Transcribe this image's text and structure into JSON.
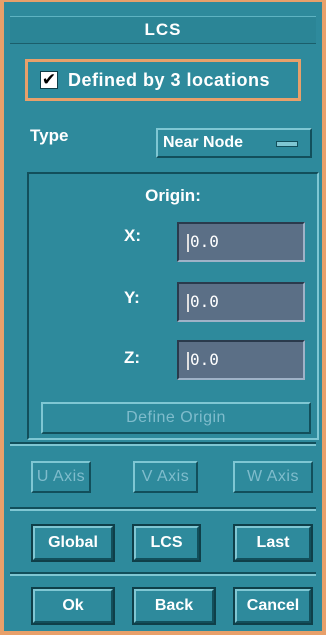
{
  "window": {
    "title": "LCS"
  },
  "checkbox": {
    "label": "Defined by 3 locations",
    "checked": true
  },
  "type": {
    "label": "Type",
    "selected": "Near Node"
  },
  "origin": {
    "title": "Origin:",
    "x_label": "X:",
    "x_value": "0.0",
    "y_label": "Y:",
    "y_value": "0.0",
    "z_label": "Z:",
    "z_value": "0.0",
    "define_button": "Define Origin"
  },
  "axes": {
    "u": "U Axis",
    "v": "V Axis",
    "w": "W Axis"
  },
  "frames": {
    "global": "Global",
    "lcs": "LCS",
    "last": "Last"
  },
  "actions": {
    "ok": "Ok",
    "back": "Back",
    "cancel": "Cancel"
  },
  "colors": {
    "panel": "#2e8a9c",
    "highlight_border": "#e8a06a",
    "field": "#5b6f86"
  }
}
